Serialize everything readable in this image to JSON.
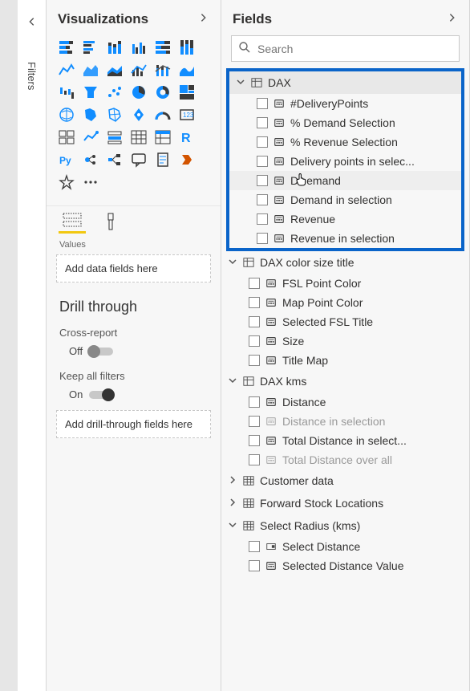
{
  "filters_tab_label": "Filters",
  "viz": {
    "title": "Visualizations",
    "format_tab_values": "Values",
    "drop_values_placeholder": "Add data fields here",
    "drill_title": "Drill through",
    "cross_report_label": "Cross-report",
    "cross_report_state": "Off",
    "keep_filters_label": "Keep all filters",
    "keep_filters_state": "On",
    "drop_drill_placeholder": "Add drill-through fields here",
    "icons": [
      [
        "stacked-bar",
        "clustered-bar",
        "stacked-column",
        "clustered-column",
        "stacked-bar-100",
        "clustered-column-100"
      ],
      [
        "line",
        "area",
        "stacked-area",
        "line-clustered",
        "line-stacked",
        "ribbon"
      ],
      [
        "waterfall",
        "funnel",
        "scatter",
        "pie",
        "donut",
        "treemap"
      ],
      [
        "map",
        "filled-map",
        "shape-map",
        "arcgis",
        "gauge",
        "card"
      ],
      [
        "multi-card",
        "kpi",
        "slicer",
        "table",
        "matrix",
        "r-visual"
      ],
      [
        "python",
        "key-influencers",
        "decomposition",
        "qna",
        "paginated",
        "power-apps"
      ],
      [
        "custom-visual",
        "more"
      ]
    ]
  },
  "fields": {
    "title": "Fields",
    "search_placeholder": "Search",
    "groups": [
      {
        "name": "DAX",
        "expanded": true,
        "highlighted": true,
        "icon": "measure-table",
        "items": [
          {
            "label": "#DeliveryPoints",
            "icon": "measure"
          },
          {
            "label": "% Demand Selection",
            "icon": "measure"
          },
          {
            "label": "% Revenue Selection",
            "icon": "measure"
          },
          {
            "label": "Delivery points in selec...",
            "icon": "measure"
          },
          {
            "label": "Demand",
            "icon": "measure",
            "hovered": true,
            "cursor": true
          },
          {
            "label": "Demand in selection",
            "icon": "measure"
          },
          {
            "label": "Revenue",
            "icon": "measure"
          },
          {
            "label": "Revenue in selection",
            "icon": "measure"
          }
        ]
      },
      {
        "name": "DAX color size title",
        "expanded": true,
        "icon": "measure-table",
        "items": [
          {
            "label": "FSL Point Color",
            "icon": "measure"
          },
          {
            "label": "Map Point Color",
            "icon": "measure"
          },
          {
            "label": "Selected FSL Title",
            "icon": "measure"
          },
          {
            "label": "Size",
            "icon": "measure"
          },
          {
            "label": "Title Map",
            "icon": "measure"
          }
        ]
      },
      {
        "name": "DAX kms",
        "expanded": true,
        "icon": "measure-table",
        "items": [
          {
            "label": "Distance",
            "icon": "measure"
          },
          {
            "label": "Distance in selection",
            "icon": "measure",
            "dim": true
          },
          {
            "label": "Total Distance in select...",
            "icon": "measure"
          },
          {
            "label": "Total Distance over all",
            "icon": "measure",
            "dim": true
          }
        ]
      },
      {
        "name": "Customer data",
        "expanded": false,
        "icon": "table"
      },
      {
        "name": "Forward Stock Locations",
        "expanded": false,
        "icon": "table"
      },
      {
        "name": "Select Radius (kms)",
        "expanded": true,
        "icon": "table",
        "items": [
          {
            "label": "Select Distance",
            "icon": "hierarchy"
          },
          {
            "label": "Selected Distance Value",
            "icon": "measure"
          }
        ]
      }
    ]
  }
}
